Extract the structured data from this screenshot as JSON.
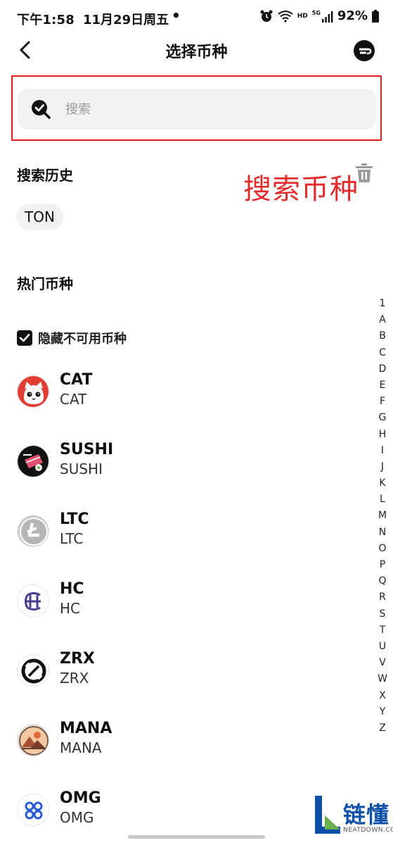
{
  "status_bar": {
    "time": "下午1:58",
    "date": "11月29日周五",
    "dot": "•",
    "hd": "HD",
    "network": "5G",
    "battery": "92%"
  },
  "nav": {
    "title": "选择币种",
    "back_icon": "chevron-left-icon",
    "brand_icon": "brand-logo-icon"
  },
  "search": {
    "placeholder": "搜索",
    "value": ""
  },
  "history": {
    "title": "搜索历史",
    "items": [
      "TON"
    ],
    "clear_icon": "trash-icon"
  },
  "annotation": "搜索币种",
  "hot": {
    "title": "热门币种"
  },
  "hide_unavailable": {
    "label": "隐藏不可用币种",
    "checked": true
  },
  "coins": [
    {
      "symbol": "CAT",
      "name": "CAT"
    },
    {
      "symbol": "SUSHI",
      "name": "SUSHI"
    },
    {
      "symbol": "LTC",
      "name": "LTC"
    },
    {
      "symbol": "HC",
      "name": "HC"
    },
    {
      "symbol": "ZRX",
      "name": "ZRX"
    },
    {
      "symbol": "MANA",
      "name": "MANA"
    },
    {
      "symbol": "OMG",
      "name": "OMG"
    }
  ],
  "alphabet": [
    "1",
    "A",
    "B",
    "C",
    "D",
    "E",
    "F",
    "G",
    "H",
    "I",
    "J",
    "K",
    "L",
    "M",
    "N",
    "O",
    "P",
    "Q",
    "R",
    "S",
    "T",
    "U",
    "V",
    "W",
    "X",
    "Y",
    "Z"
  ],
  "watermark": {
    "text": "链懂",
    "sub": "NEATDOWN.COM"
  }
}
